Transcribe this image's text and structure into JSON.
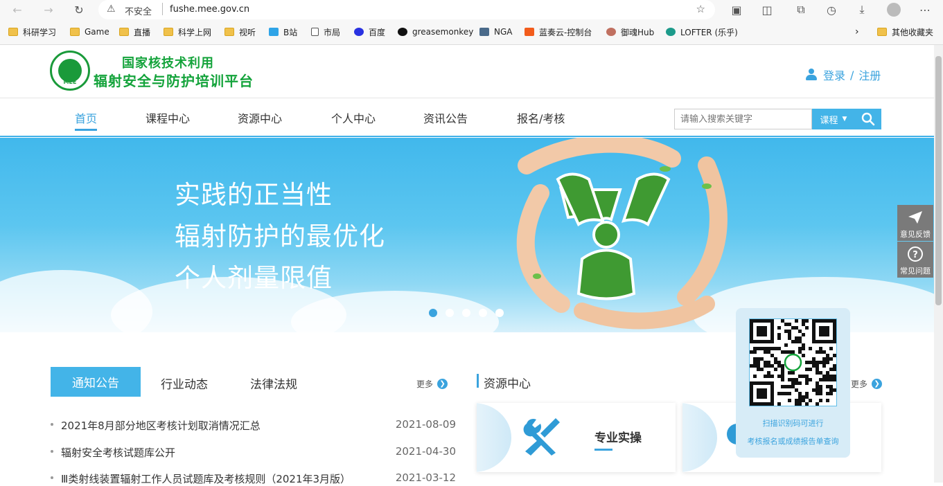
{
  "browser": {
    "security_label": "不安全",
    "url": "fushe.mee.gov.cn",
    "bookmarks": [
      "科研学习",
      "Game",
      "直播",
      "科学上网",
      "视听",
      "B站",
      "市局",
      "百度",
      "greasemonkey",
      "NGA",
      "蓝奏云-控制台",
      "御魂Hub",
      "LOFTER (乐乎)"
    ],
    "other_bookmarks": "其他收藏夹"
  },
  "site": {
    "logo_emblem_text": "MEE",
    "logo_line1": "国家核技术利用",
    "logo_line2": "辐射安全与防护培训平台",
    "login": "登录",
    "slash": "/",
    "register": "注册"
  },
  "nav": {
    "items": [
      "首页",
      "课程中心",
      "资源中心",
      "个人中心",
      "资讯公告",
      "报名/考核"
    ],
    "search_placeholder": "请输入搜索关键字",
    "search_scope": "课程"
  },
  "banner": {
    "slogans": [
      "实践的正当性",
      "辐射防护的最优化",
      "个人剂量限值"
    ],
    "slide_count": 5,
    "active_slide": 1
  },
  "side": {
    "feedback": "意见反馈",
    "faq": "常见问题"
  },
  "notice": {
    "tabs": [
      "通知公告",
      "行业动态",
      "法律法规"
    ],
    "more": "更多",
    "items": [
      {
        "title": "2021年8月部分地区考核计划取消情况汇总",
        "date": "2021-08-09"
      },
      {
        "title": "辐射安全考核试题库公开",
        "date": "2021-04-30"
      },
      {
        "title": "Ⅲ类射线装置辐射工作人员试题库及考核规则（2021年3月版）",
        "date": "2021-03-12"
      }
    ]
  },
  "resources": {
    "title": "资源中心",
    "more": "更多",
    "card1_label": "专业实操"
  },
  "qr": {
    "line1": "扫描识别码可进行",
    "line2": "考核报名或成绩报告单查询"
  },
  "colors": {
    "accent": "#3aa3de",
    "logo_green": "#14a33b",
    "banner_sky": "#41b8ec"
  }
}
